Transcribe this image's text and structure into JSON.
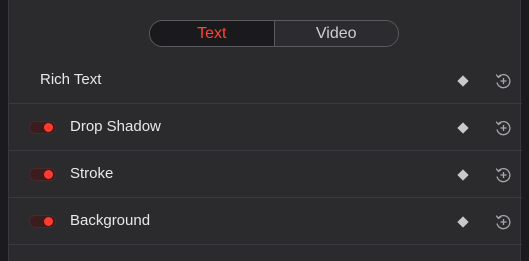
{
  "tabs": [
    {
      "label": "Text",
      "active": true
    },
    {
      "label": "Video",
      "active": false
    }
  ],
  "rows": [
    {
      "label": "Rich Text",
      "has_toggle": false
    },
    {
      "label": "Drop Shadow",
      "has_toggle": true,
      "enabled": true
    },
    {
      "label": "Stroke",
      "has_toggle": true,
      "enabled": true
    },
    {
      "label": "Background",
      "has_toggle": true,
      "enabled": true
    }
  ],
  "icons": {
    "keyframe": "diamond-keyframe-icon",
    "reset": "reset-icon"
  },
  "colors": {
    "accent": "#ff3b30",
    "panel_bg": "#2b2b2e",
    "text": "#e8e8ea"
  }
}
